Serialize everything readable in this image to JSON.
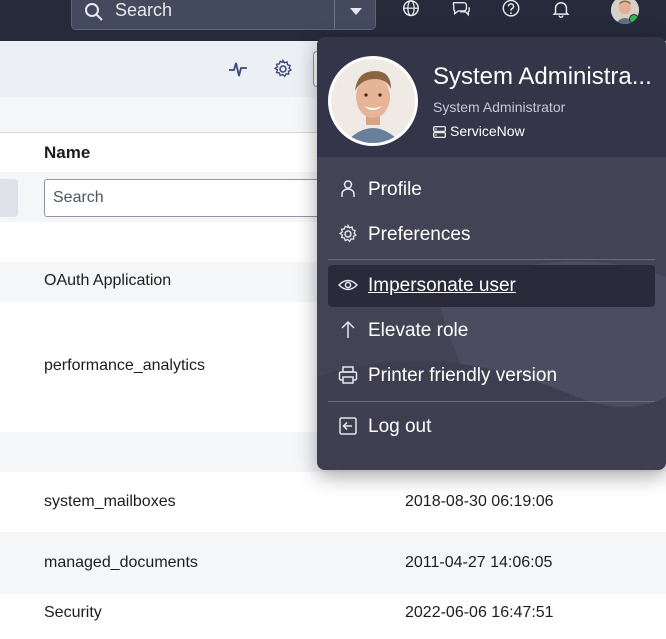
{
  "header": {
    "search_placeholder": "Search",
    "icons": [
      "search-icon",
      "chevron-down-icon",
      "globe-icon",
      "chat-icon",
      "help-icon",
      "bell-icon"
    ],
    "colors": {
      "background": "#262b3b",
      "online_status": "#2fb84b"
    }
  },
  "toolbar": {
    "icons": [
      "activity-icon",
      "gear-icon"
    ]
  },
  "list": {
    "column_header": "Name",
    "filter_placeholder": "Search",
    "rows": [
      {
        "name": "OAuth Application",
        "date": ""
      },
      {
        "name": "performance_analytics",
        "date": ""
      },
      {
        "name": "system_mailboxes",
        "date": "2018-08-30 06:19:06"
      },
      {
        "name": "managed_documents",
        "date": "2011-04-27 14:06:05"
      },
      {
        "name": "Security",
        "date": "2022-06-06 16:47:51"
      }
    ]
  },
  "user_menu": {
    "name": "System Administra...",
    "role": "System Administrator",
    "instance": "ServiceNow",
    "items": [
      {
        "label": "Profile",
        "icon": "person-icon"
      },
      {
        "label": "Preferences",
        "icon": "gear-icon"
      },
      {
        "label": "Impersonate user",
        "icon": "eye-icon"
      },
      {
        "label": "Elevate role",
        "icon": "arrow-up-icon"
      },
      {
        "label": "Printer friendly version",
        "icon": "printer-icon"
      },
      {
        "label": "Log out",
        "icon": "logout-icon"
      }
    ],
    "colors": {
      "background": "#444356",
      "header": "#35354a",
      "active_item": "#2a2a3b"
    }
  }
}
